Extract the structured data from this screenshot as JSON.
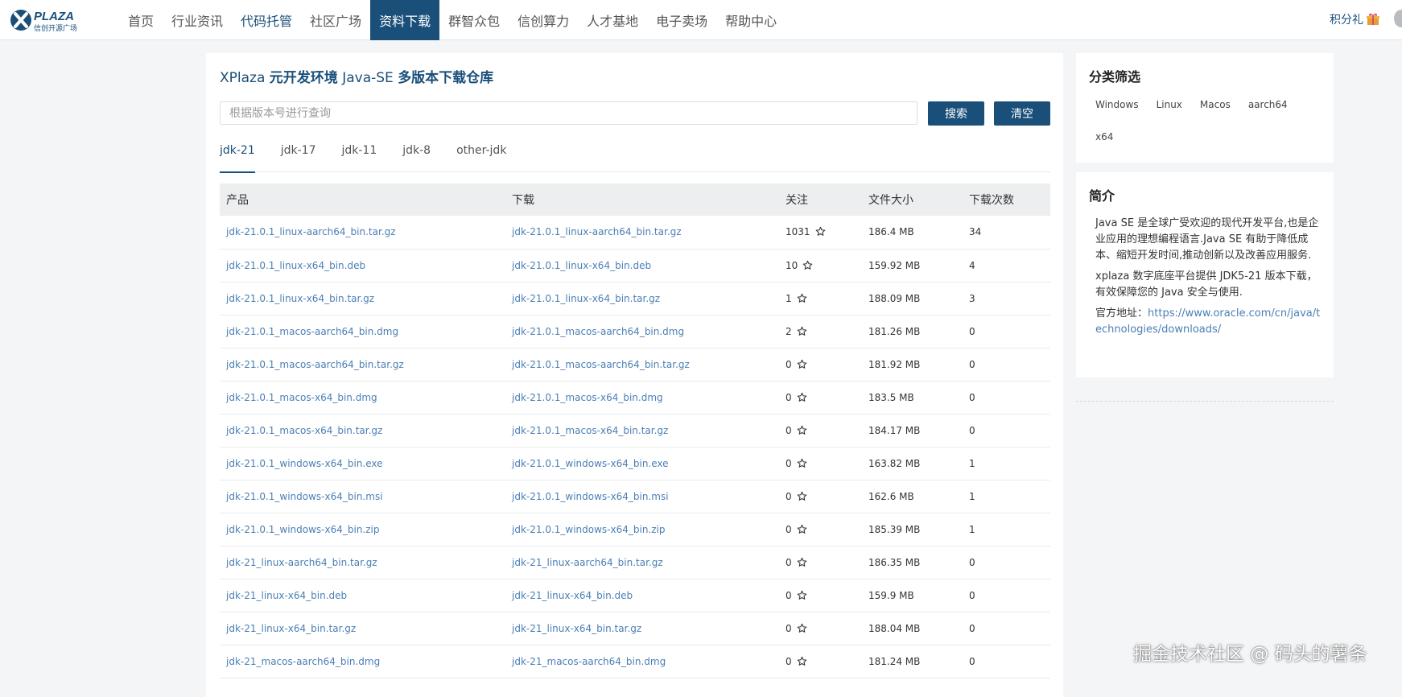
{
  "logo": {
    "brand": "PLAZA",
    "tagline": "信创开源广场"
  },
  "nav": {
    "items": [
      {
        "label": "首页"
      },
      {
        "label": "行业资讯"
      },
      {
        "label": "代码托管"
      },
      {
        "label": "社区广场"
      },
      {
        "label": "资料下载"
      },
      {
        "label": "群智众包"
      },
      {
        "label": "信创算力"
      },
      {
        "label": "人才基地"
      },
      {
        "label": "电子卖场"
      },
      {
        "label": "帮助中心"
      }
    ],
    "active": "资料下载",
    "points_label": "积分礼"
  },
  "main": {
    "title_prefix": "XPlaza ",
    "title_cn1": "元开发环境",
    "title_mid": " Java-SE ",
    "title_cn2": "多版本下载仓库",
    "search": {
      "placeholder": "根据版本号进行查询",
      "value": ""
    },
    "search_button": "搜索",
    "clear_button": "清空",
    "tabs": [
      {
        "label": "jdk-21"
      },
      {
        "label": "jdk-17"
      },
      {
        "label": "jdk-11"
      },
      {
        "label": "jdk-8"
      },
      {
        "label": "other-jdk"
      }
    ],
    "active_tab": "jdk-21",
    "table": {
      "headers": [
        "产品",
        "下载",
        "关注",
        "文件大小",
        "下载次数"
      ],
      "rows": [
        {
          "product": "jdk-21.0.1_linux-aarch64_bin.tar.gz",
          "download": "jdk-21.0.1_linux-aarch64_bin.tar.gz",
          "follow": "1031",
          "size": "186.4 MB",
          "downloads": "34"
        },
        {
          "product": "jdk-21.0.1_linux-x64_bin.deb",
          "download": "jdk-21.0.1_linux-x64_bin.deb",
          "follow": "10",
          "size": "159.92 MB",
          "downloads": "4"
        },
        {
          "product": "jdk-21.0.1_linux-x64_bin.tar.gz",
          "download": "jdk-21.0.1_linux-x64_bin.tar.gz",
          "follow": "1",
          "size": "188.09 MB",
          "downloads": "3"
        },
        {
          "product": "jdk-21.0.1_macos-aarch64_bin.dmg",
          "download": "jdk-21.0.1_macos-aarch64_bin.dmg",
          "follow": "2",
          "size": "181.26 MB",
          "downloads": "0"
        },
        {
          "product": "jdk-21.0.1_macos-aarch64_bin.tar.gz",
          "download": "jdk-21.0.1_macos-aarch64_bin.tar.gz",
          "follow": "0",
          "size": "181.92 MB",
          "downloads": "0"
        },
        {
          "product": "jdk-21.0.1_macos-x64_bin.dmg",
          "download": "jdk-21.0.1_macos-x64_bin.dmg",
          "follow": "0",
          "size": "183.5 MB",
          "downloads": "0"
        },
        {
          "product": "jdk-21.0.1_macos-x64_bin.tar.gz",
          "download": "jdk-21.0.1_macos-x64_bin.tar.gz",
          "follow": "0",
          "size": "184.17 MB",
          "downloads": "0"
        },
        {
          "product": "jdk-21.0.1_windows-x64_bin.exe",
          "download": "jdk-21.0.1_windows-x64_bin.exe",
          "follow": "0",
          "size": "163.82 MB",
          "downloads": "1"
        },
        {
          "product": "jdk-21.0.1_windows-x64_bin.msi",
          "download": "jdk-21.0.1_windows-x64_bin.msi",
          "follow": "0",
          "size": "162.6 MB",
          "downloads": "1"
        },
        {
          "product": "jdk-21.0.1_windows-x64_bin.zip",
          "download": "jdk-21.0.1_windows-x64_bin.zip",
          "follow": "0",
          "size": "185.39 MB",
          "downloads": "1"
        },
        {
          "product": "jdk-21_linux-aarch64_bin.tar.gz",
          "download": "jdk-21_linux-aarch64_bin.tar.gz",
          "follow": "0",
          "size": "186.35 MB",
          "downloads": "0"
        },
        {
          "product": "jdk-21_linux-x64_bin.deb",
          "download": "jdk-21_linux-x64_bin.deb",
          "follow": "0",
          "size": "159.9 MB",
          "downloads": "0"
        },
        {
          "product": "jdk-21_linux-x64_bin.tar.gz",
          "download": "jdk-21_linux-x64_bin.tar.gz",
          "follow": "0",
          "size": "188.04 MB",
          "downloads": "0"
        },
        {
          "product": "jdk-21_macos-aarch64_bin.dmg",
          "download": "jdk-21_macos-aarch64_bin.dmg",
          "follow": "0",
          "size": "181.24 MB",
          "downloads": "0"
        }
      ]
    }
  },
  "sidebar": {
    "filter_title": "分类筛选",
    "filters": [
      {
        "label": "Windows"
      },
      {
        "label": "Linux"
      },
      {
        "label": "Macos"
      },
      {
        "label": "aarch64"
      },
      {
        "label": "x64"
      }
    ],
    "intro_title": "简介",
    "intro_p1": "Java SE 是全球广受欢迎的现代开发平台,也是企业应用的理想编程语言.Java SE 有助于降低成本、缩短开发时间,推动创新以及改善应用服务.",
    "intro_p2": "xplaza 数字底座平台提供 JDK5-21 版本下载，有效保障您的 Java 安全与使用.",
    "official_label": "官方地址：",
    "official_url": "https://www.oracle.com/cn/java/technologies/downloads/"
  },
  "watermark": "掘金技术社区 @ 码头的薯条",
  "colors": {
    "brand": "#1a4f7a",
    "link": "#4a7fb5",
    "background": "#f4f5f7"
  }
}
